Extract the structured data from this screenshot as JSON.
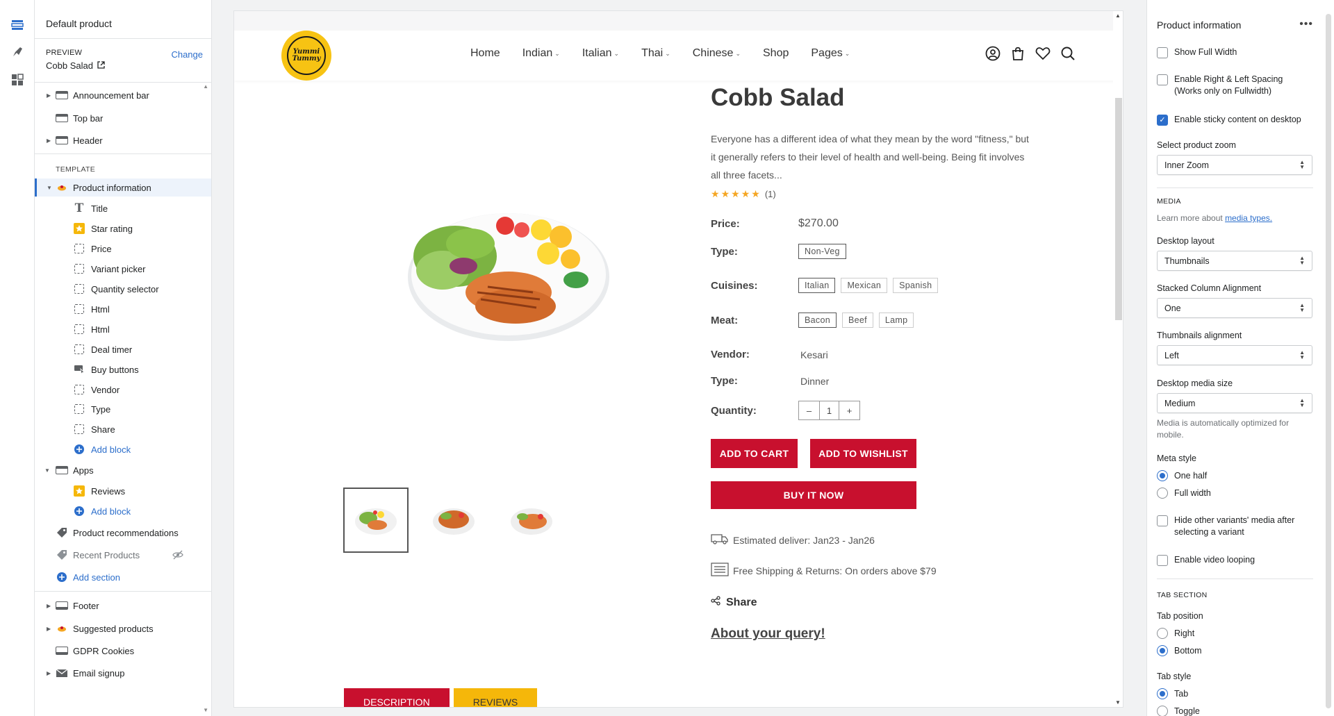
{
  "left_panel": {
    "title": "Default product",
    "preview_label": "PREVIEW",
    "preview_value": "Cobb Salad",
    "change_label": "Change",
    "template_label": "TEMPLATE",
    "header_items": [
      {
        "label": "Announcement bar"
      },
      {
        "label": "Top bar"
      },
      {
        "label": "Header"
      }
    ],
    "product_information": "Product information",
    "blocks": [
      {
        "label": "Title",
        "icon": "text-icon"
      },
      {
        "label": "Star rating",
        "icon": "star-icon"
      },
      {
        "label": "Price",
        "icon": "block-icon"
      },
      {
        "label": "Variant picker",
        "icon": "block-icon"
      },
      {
        "label": "Quantity selector",
        "icon": "block-icon"
      },
      {
        "label": "Html",
        "icon": "block-icon"
      },
      {
        "label": "Html",
        "icon": "block-icon"
      },
      {
        "label": "Deal timer",
        "icon": "block-icon"
      },
      {
        "label": "Buy buttons",
        "icon": "buy-buttons-icon"
      },
      {
        "label": "Vendor",
        "icon": "block-icon"
      },
      {
        "label": "Type",
        "icon": "block-icon"
      },
      {
        "label": "Share",
        "icon": "block-icon"
      }
    ],
    "add_block": "Add block",
    "apps": "Apps",
    "apps_blocks": [
      {
        "label": "Reviews"
      }
    ],
    "product_recommendations": "Product recommendations",
    "recent_products": "Recent Products",
    "add_section": "Add section",
    "footer_items": [
      {
        "label": "Footer"
      },
      {
        "label": "Suggested products"
      },
      {
        "label": "GDPR Cookies"
      },
      {
        "label": "Email signup"
      }
    ]
  },
  "site": {
    "logo_text_1": "Yummi",
    "logo_text_2": "Tummy",
    "nav": [
      {
        "label": "Home",
        "dropdown": false
      },
      {
        "label": "Indian",
        "dropdown": true
      },
      {
        "label": "Italian",
        "dropdown": true
      },
      {
        "label": "Thai",
        "dropdown": true
      },
      {
        "label": "Chinese",
        "dropdown": true
      },
      {
        "label": "Shop",
        "dropdown": false
      },
      {
        "label": "Pages",
        "dropdown": true
      }
    ]
  },
  "product": {
    "title": "Cobb Salad",
    "description": "Everyone has a different idea of what they mean by the word \"fitness,\" but it generally refers to their level of health and well-being. Being fit involves all three facets...",
    "rating_count": "(1)",
    "rating": 5,
    "price_label": "Price:",
    "price": "$270.00",
    "type_label": "Type:",
    "type_options": [
      "Non-Veg"
    ],
    "cuisines_label": "Cuisines:",
    "cuisines": [
      "Italian",
      "Mexican",
      "Spanish"
    ],
    "meat_label": "Meat:",
    "meat": [
      "Bacon",
      "Beef",
      "Lamp"
    ],
    "vendor_label": "Vendor:",
    "vendor": "Kesari",
    "type2_label": "Type:",
    "type2": "Dinner",
    "quantity_label": "Quantity:",
    "quantity": "1",
    "minus": "–",
    "plus": "+",
    "add_to_cart": "ADD TO CART",
    "add_to_wishlist": "ADD TO WISHLIST",
    "buy_now": "BUY IT NOW",
    "estimated": "Estimated deliver: Jan23 - Jan26",
    "shipping": "Free Shipping & Returns: On orders above $79",
    "share": "Share",
    "query": "About your query!",
    "tab_description": "DESCRIPTION",
    "tab_reviews": "REVIEWS"
  },
  "right_panel": {
    "title": "Product information",
    "show_full_width": "Show Full Width",
    "enable_spacing": "Enable Right & Left Spacing (Works only on Fullwidth)",
    "enable_sticky": "Enable sticky content on desktop",
    "select_zoom_label": "Select product zoom",
    "select_zoom_value": "Inner Zoom",
    "media_heading": "MEDIA",
    "learn_more": "Learn more about ",
    "media_types": "media types.",
    "desktop_layout_label": "Desktop layout",
    "desktop_layout_value": "Thumbnails",
    "stacked_label": "Stacked Column Alignment",
    "stacked_value": "One",
    "thumb_align_label": "Thumbnails alignment",
    "thumb_align_value": "Left",
    "media_size_label": "Desktop media size",
    "media_size_value": "Medium",
    "media_help": "Media is automatically optimized for mobile.",
    "meta_style_label": "Meta style",
    "meta_one_half": "One half",
    "meta_full_width": "Full width",
    "hide_variants": "Hide other variants' media after selecting a variant",
    "enable_looping": "Enable video looping",
    "tab_section_heading": "TAB SECTION",
    "tab_position_label": "Tab position",
    "tab_right": "Right",
    "tab_bottom": "Bottom",
    "tab_style_label": "Tab style",
    "tab_style_tab": "Tab",
    "tab_style_toggle": "Toggle"
  },
  "colors": {
    "accent_blue": "#2c6ecb",
    "brand_red": "#c8102e",
    "brand_yellow": "#f5b70a"
  }
}
